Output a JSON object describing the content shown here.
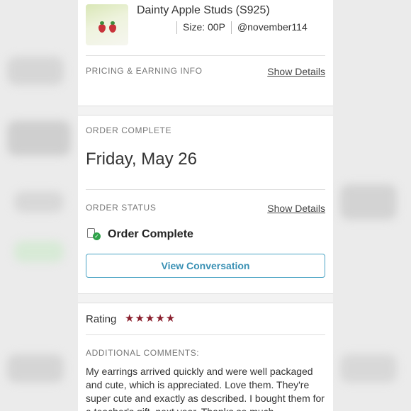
{
  "product": {
    "title": "Dainty Apple Studs (S925)",
    "size": "Size: 00P",
    "seller": "@november114"
  },
  "pricing": {
    "label": "PRICING & EARNING INFO",
    "details_link": "Show Details"
  },
  "order": {
    "label": "ORDER COMPLETE",
    "date": "Friday, May 26"
  },
  "status": {
    "label": "ORDER STATUS",
    "details_link": "Show Details",
    "value": "Order Complete",
    "button": "View Conversation"
  },
  "rating": {
    "label": "Rating",
    "stars": 5,
    "star_glyph": "★★★★★",
    "star_color": "#8a1f2d"
  },
  "comments": {
    "label": "ADDITIONAL COMMENTS:",
    "text": "My earrings arrived quickly and were well packaged and cute, which is appreciated. Love them. They're super cute and exactly as described. I bought them for a teacher's gift, next year. Thanks so much."
  },
  "colors": {
    "accent": "#3990b4",
    "status_check": "#2fa24a"
  }
}
